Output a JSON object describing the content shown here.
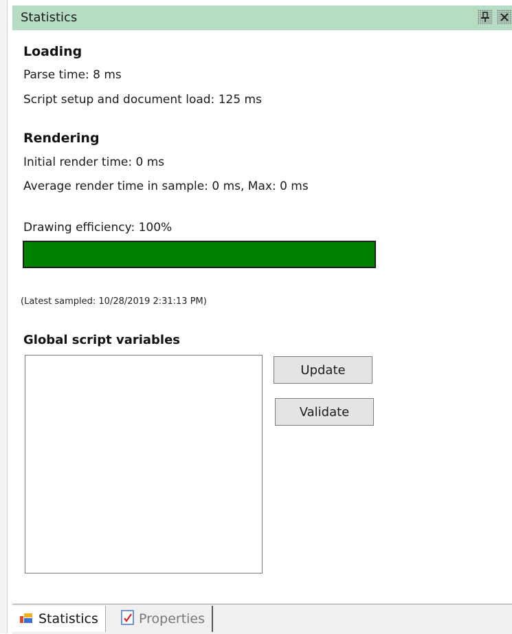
{
  "window": {
    "title": "Statistics"
  },
  "loading": {
    "heading": "Loading",
    "parse_time": "Parse time: 8 ms",
    "script_setup": "Script setup and document load: 125 ms"
  },
  "rendering": {
    "heading": "Rendering",
    "initial_render": "Initial render time: 0 ms",
    "average_render": "Average render time in sample: 0 ms, Max: 0 ms"
  },
  "efficiency": {
    "label": "Drawing efficiency: 100%",
    "value_percent": 100,
    "bar_color": "#008000"
  },
  "sampled": "(Latest sampled: 10/28/2019 2:31:13 PM)",
  "globals": {
    "heading": "Global script variables",
    "update_label": "Update",
    "validate_label": "Validate"
  },
  "tabs": [
    {
      "label": "Statistics",
      "icon": "statistics-chart-icon",
      "active": true
    },
    {
      "label": "Properties",
      "icon": "properties-page-icon",
      "active": false
    }
  ]
}
